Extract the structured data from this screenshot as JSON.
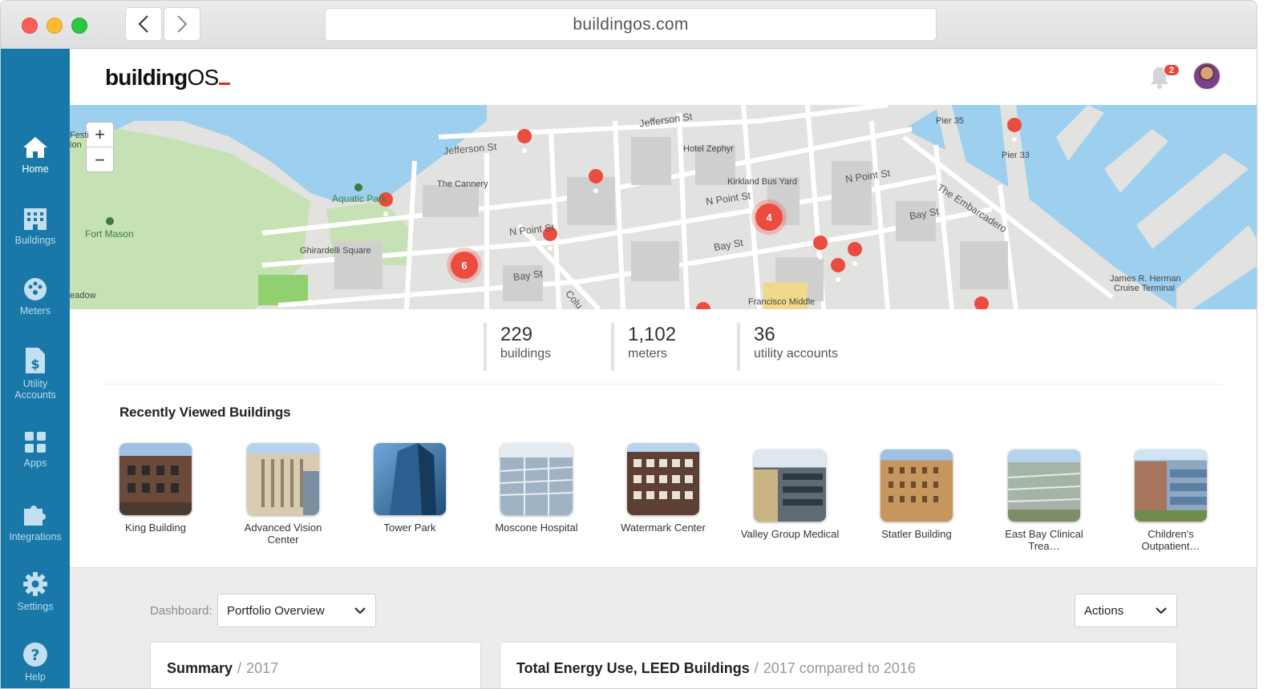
{
  "browser": {
    "url": "buildingos.com"
  },
  "brand": {
    "logo_bold": "building",
    "logo_light": "OS",
    "accent": "#e8232e",
    "sidebar_color": "#1978a8"
  },
  "sidebar": {
    "items": [
      {
        "label": "Home",
        "icon": "home-icon"
      },
      {
        "label": "Buildings",
        "icon": "buildings-icon"
      },
      {
        "label": "Meters",
        "icon": "meters-icon"
      },
      {
        "label": "Utility Accounts",
        "icon": "utility-accounts-icon"
      },
      {
        "label": "Apps",
        "icon": "apps-icon"
      },
      {
        "label": "Integrations",
        "icon": "integrations-icon"
      },
      {
        "label": "Settings",
        "icon": "settings-icon"
      },
      {
        "label": "Help",
        "icon": "help-icon"
      }
    ]
  },
  "header": {
    "notification_count": "2"
  },
  "map": {
    "zoom_in": "+",
    "zoom_out": "−",
    "labels": {
      "jefferson_1": "Jefferson St",
      "jefferson_2": "Jefferson St",
      "cannery": "The Cannery",
      "hotel_zephyr": "Hotel Zephyr",
      "kirkland": "Kirkland Bus Yard",
      "npoint_1": "N Point St",
      "npoint_2": "N Point St",
      "npoint_3": "N Point St",
      "bay_1": "Bay St",
      "bay_2": "Bay St",
      "bay_3": "Bay St",
      "embarcadero": "The Embarcadero",
      "pier35": "Pier 35",
      "pier33": "Pier 33",
      "aquatic_park": "Aquatic Park",
      "fort_mason": "Fort Mason",
      "ghirardelli": "Ghirardelli Square",
      "francisco": "Francisco Middle",
      "cruise_1": "James R. Herman",
      "cruise_2": "Cruise Terminal",
      "festi_1": "Festi",
      "festi_2": "ion",
      "meadow": "eadow",
      "columbus": "Colu"
    },
    "clusters": [
      {
        "count": "6"
      },
      {
        "count": "4"
      }
    ]
  },
  "stats": [
    {
      "value": "229",
      "label": "buildings"
    },
    {
      "value": "1,102",
      "label": "meters"
    },
    {
      "value": "36",
      "label": "utility accounts"
    }
  ],
  "recent": {
    "title": "Recently Viewed Buildings",
    "buildings": [
      {
        "name": "King Building"
      },
      {
        "name": "Advanced Vision Center"
      },
      {
        "name": "Tower Park"
      },
      {
        "name": "Moscone Hospital"
      },
      {
        "name": "Watermark Center"
      },
      {
        "name": "Valley Group Medical"
      },
      {
        "name": "Statler Building"
      },
      {
        "name": "East Bay Clinical Trea…"
      },
      {
        "name": "Children's Outpatient…"
      }
    ]
  },
  "dashboard": {
    "label": "Dashboard:",
    "selected": "Portfolio Overview",
    "actions": "Actions",
    "summary_title": "Summary",
    "summary_year": "2017",
    "energy_title": "Total Energy Use, LEED Buildings",
    "energy_sub": "2017 compared to 2016"
  }
}
